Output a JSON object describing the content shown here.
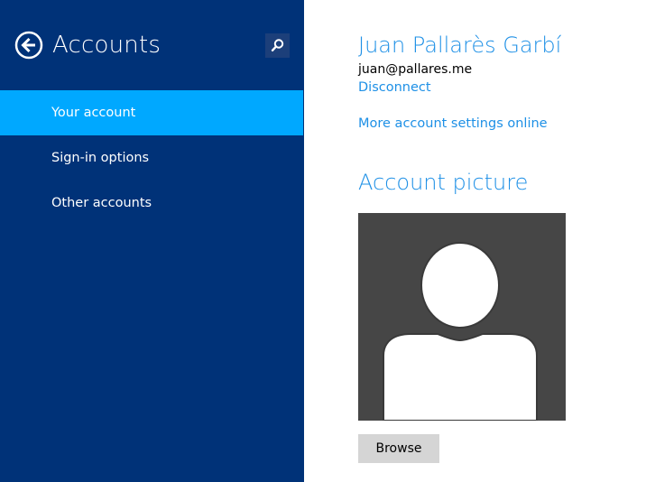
{
  "sidebar": {
    "title": "Accounts",
    "back_icon": "back-arrow-icon",
    "search_icon": "search-icon",
    "items": [
      {
        "label": "Your account",
        "selected": true
      },
      {
        "label": "Sign-in options",
        "selected": false
      },
      {
        "label": "Other accounts",
        "selected": false
      }
    ]
  },
  "account": {
    "name": "Juan Pallarès Garbí",
    "email": "juan@pallares.me",
    "disconnect_label": "Disconnect",
    "more_settings_label": "More account settings online"
  },
  "picture": {
    "section_title": "Account picture",
    "placeholder_icon": "user-silhouette-icon",
    "browse_label": "Browse"
  },
  "colors": {
    "sidebar_bg": "#003278",
    "selected_bg": "#00a8ff",
    "accent": "#1e90e6",
    "picture_bg": "#464646",
    "button_bg": "#d5d5d5"
  }
}
